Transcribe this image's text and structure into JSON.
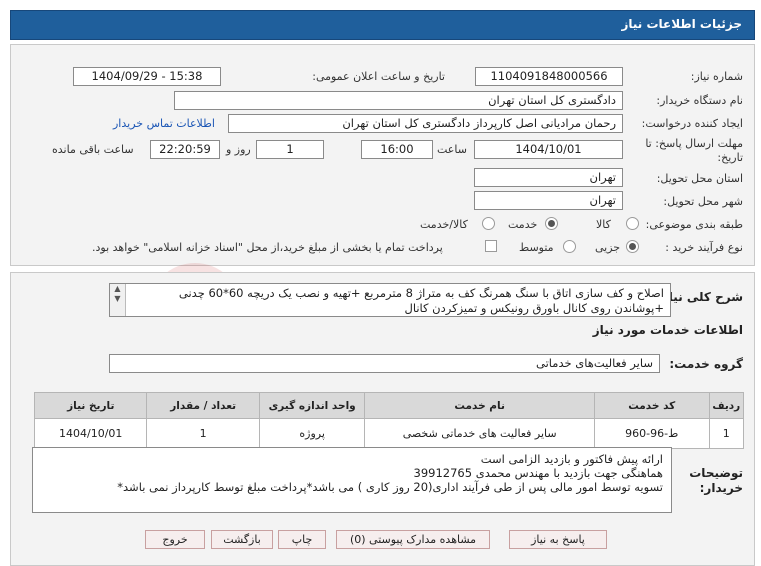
{
  "header": {
    "title": "جزئیات اطلاعات نیاز"
  },
  "fields": {
    "need_number_label": "شماره نیاز:",
    "need_number": "1104091848000566",
    "announce_label": "تاریخ و ساعت اعلان عمومی:",
    "announce_value": "1404/09/29 - 15:38",
    "buyer_org_label": "نام دستگاه خریدار:",
    "buyer_org": "دادگستری کل استان تهران",
    "creator_label": "ایجاد کننده درخواست:",
    "creator": "رحمان مرادیانی اصل کارپرداز دادگستری کل استان تهران",
    "contact_link": "اطلاعات تماس خریدار",
    "deadline_label_1": "مهلت ارسال پاسخ: تا",
    "deadline_label_2": "تاریخ:",
    "deadline_date": "1404/10/01",
    "time_label": "ساعت",
    "deadline_time": "16:00",
    "day_count": "1",
    "days_and_label": "روز و",
    "remaining_time": "22:20:59",
    "remaining_label": "ساعت باقی مانده",
    "province_label": "استان محل تحویل:",
    "province": "تهران",
    "city_label": "شهر محل تحویل:",
    "city": "تهران",
    "category_label": "طبقه بندی موضوعی:",
    "category_options": [
      "کالا",
      "خدمت",
      "کالا/خدمت"
    ],
    "category_selected": "خدمت",
    "process_label": "نوع فرآیند خرید :",
    "process_options": [
      "جزیی",
      "متوسط"
    ],
    "process_selected": "جزیی",
    "payment_note": "پرداخت تمام یا بخشی از مبلغ خرید،از محل \"اسناد خزانه اسلامی\" خواهد بود."
  },
  "summary": {
    "label": "شرح کلی نیاز:",
    "line1": "اصلاح و کف سازی اتاق با سنگ همرنگ کف به متراژ 8 مترمربع +تهیه و نصب یک دریچه 60*60 چدنی",
    "line2": "+پوشاندن روی کانال باورق رونیکس و تمیزکردن کانال"
  },
  "services": {
    "section_title": "اطلاعات خدمات مورد نیاز",
    "group_label": "گروه خدمت:",
    "group_value": "سایر فعالیت‌های خدماتی",
    "columns": [
      "ردیف",
      "کد خدمت",
      "نام خدمت",
      "واحد اندازه گیری",
      "تعداد / مقدار",
      "تاریخ نیاز"
    ],
    "rows": [
      [
        "1",
        "ط-96-960",
        "سایر فعالیت های خدماتی شخصی",
        "پروژه",
        "1",
        "1404/10/01"
      ]
    ]
  },
  "notes": {
    "label_1": "توضیحات",
    "label_2": "خریدار:",
    "line1": "ارائه پیش فاکتور و بازدید الزامی است",
    "line2": "هماهنگی جهت بازدید با مهندس محمدی 39912765",
    "line3": "تسویه توسط امور مالی پس از طی فرآیند اداری(20 روز کاری )  می باشد*پرداخت مبلغ توسط کارپرداز نمی باشد*"
  },
  "buttons": {
    "reply": "پاسخ به نیاز",
    "view_docs": "مشاهده مدارک پیوستی (0)",
    "print": "چاپ",
    "back": "بازگشت",
    "exit": "خروج"
  },
  "watermark": {
    "text": "AriaTender.net"
  }
}
